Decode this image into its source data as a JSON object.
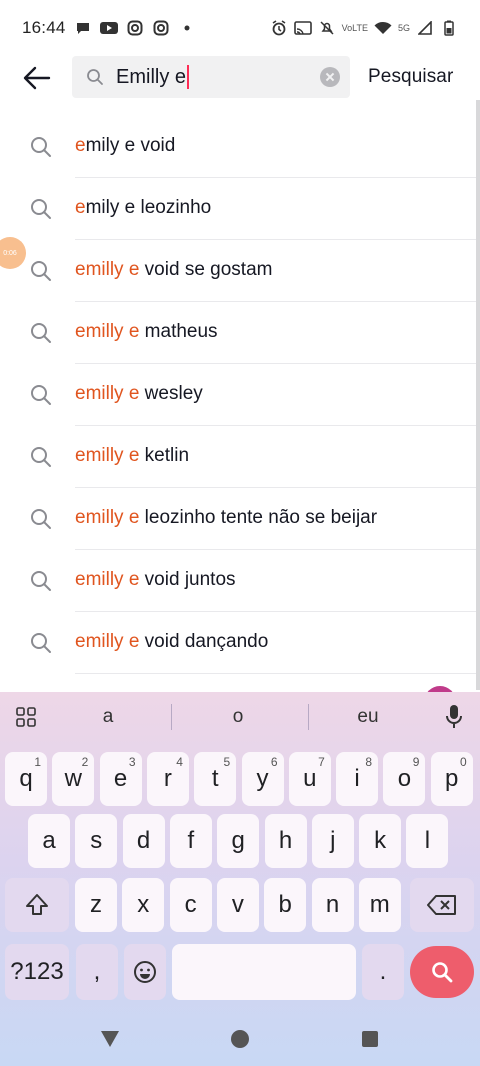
{
  "status_bar": {
    "time": "16:44",
    "network_label": "5G",
    "volte_label": "VoLTE"
  },
  "header": {
    "search_value": "Emilly e",
    "search_button_label": "Pesquisar"
  },
  "suggestions": [
    {
      "highlight": "e",
      "rest": "mily e void"
    },
    {
      "highlight": "e",
      "rest": "mily e leozinho"
    },
    {
      "highlight": "emilly e",
      "rest": " void se gostam"
    },
    {
      "highlight": "emilly e",
      "rest": " matheus"
    },
    {
      "highlight": "emilly e",
      "rest": " wesley"
    },
    {
      "highlight": "emilly e",
      "rest": " ketlin"
    },
    {
      "highlight": "emilly e",
      "rest": " leozinho tente não se beijar"
    },
    {
      "highlight": "emilly e",
      "rest": " void juntos"
    },
    {
      "highlight": "emilly e",
      "rest": " void dançando"
    }
  ],
  "side_badge": "0:06",
  "keyboard": {
    "suggestions": [
      "a",
      "o",
      "eu"
    ],
    "row1": [
      {
        "key": "q",
        "hint": "1"
      },
      {
        "key": "w",
        "hint": "2"
      },
      {
        "key": "e",
        "hint": "3"
      },
      {
        "key": "r",
        "hint": "4"
      },
      {
        "key": "t",
        "hint": "5"
      },
      {
        "key": "y",
        "hint": "6"
      },
      {
        "key": "u",
        "hint": "7"
      },
      {
        "key": "i",
        "hint": "8"
      },
      {
        "key": "o",
        "hint": "9"
      },
      {
        "key": "p",
        "hint": "0"
      }
    ],
    "row2": [
      "a",
      "s",
      "d",
      "f",
      "g",
      "h",
      "j",
      "k",
      "l"
    ],
    "row3": [
      "z",
      "x",
      "c",
      "v",
      "b",
      "n",
      "m"
    ],
    "symbols_label": "?123",
    "comma_label": ",",
    "period_label": ".",
    "accent_color": "#ee5d6c"
  },
  "colors": {
    "highlight": "#e0551f",
    "caret": "#fe2c55"
  }
}
